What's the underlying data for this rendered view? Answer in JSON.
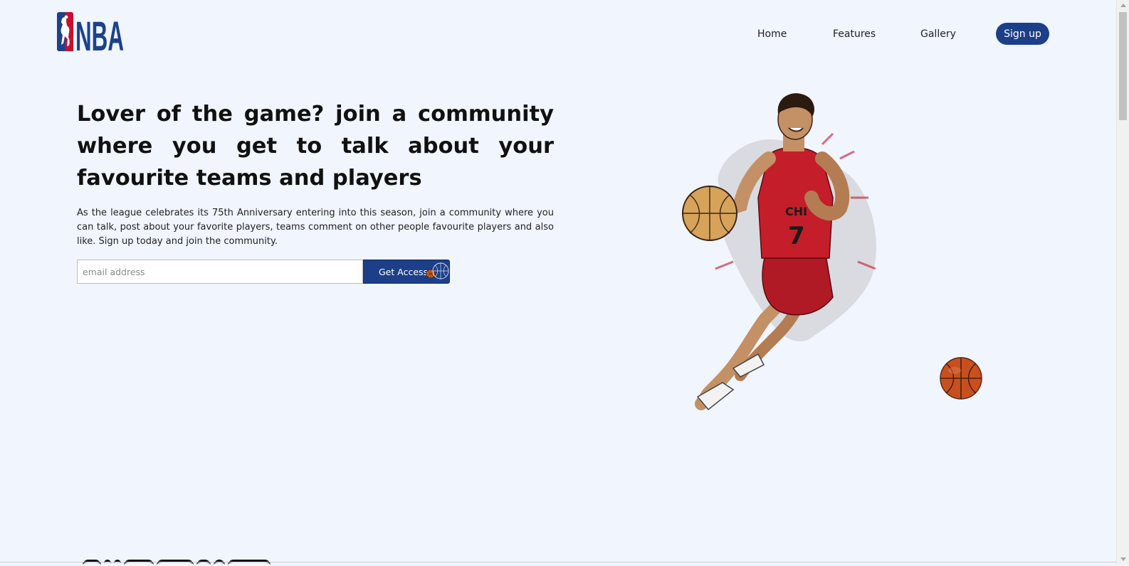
{
  "header": {
    "logo_alt": "NBA",
    "logo_text": "NBA",
    "nav": [
      {
        "label": "Home"
      },
      {
        "label": "Features"
      },
      {
        "label": "Gallery"
      }
    ],
    "signup_label": "Sign up"
  },
  "hero": {
    "title": "Lover of the game? join a community where you get to talk about your favourite teams and players",
    "body": "As the league celebrates its 75th Anniversary entering into this season, join a community where you can talk, post about your favorite players, teams comment on other people favourite players and also like. Sign up today and join the community.",
    "email_placeholder": "email address",
    "cta_label": "Get Access"
  },
  "colors": {
    "background": "#f0f5fe",
    "brand_blue": "#1d3f88",
    "nba_red": "#c8102e",
    "jersey_red": "#b01a24"
  },
  "icons": {
    "logo": "nba-logo-icon",
    "cta": "basketball-icon",
    "hero_image": "basketball-player-illustration",
    "decor": "basketball-icon"
  }
}
